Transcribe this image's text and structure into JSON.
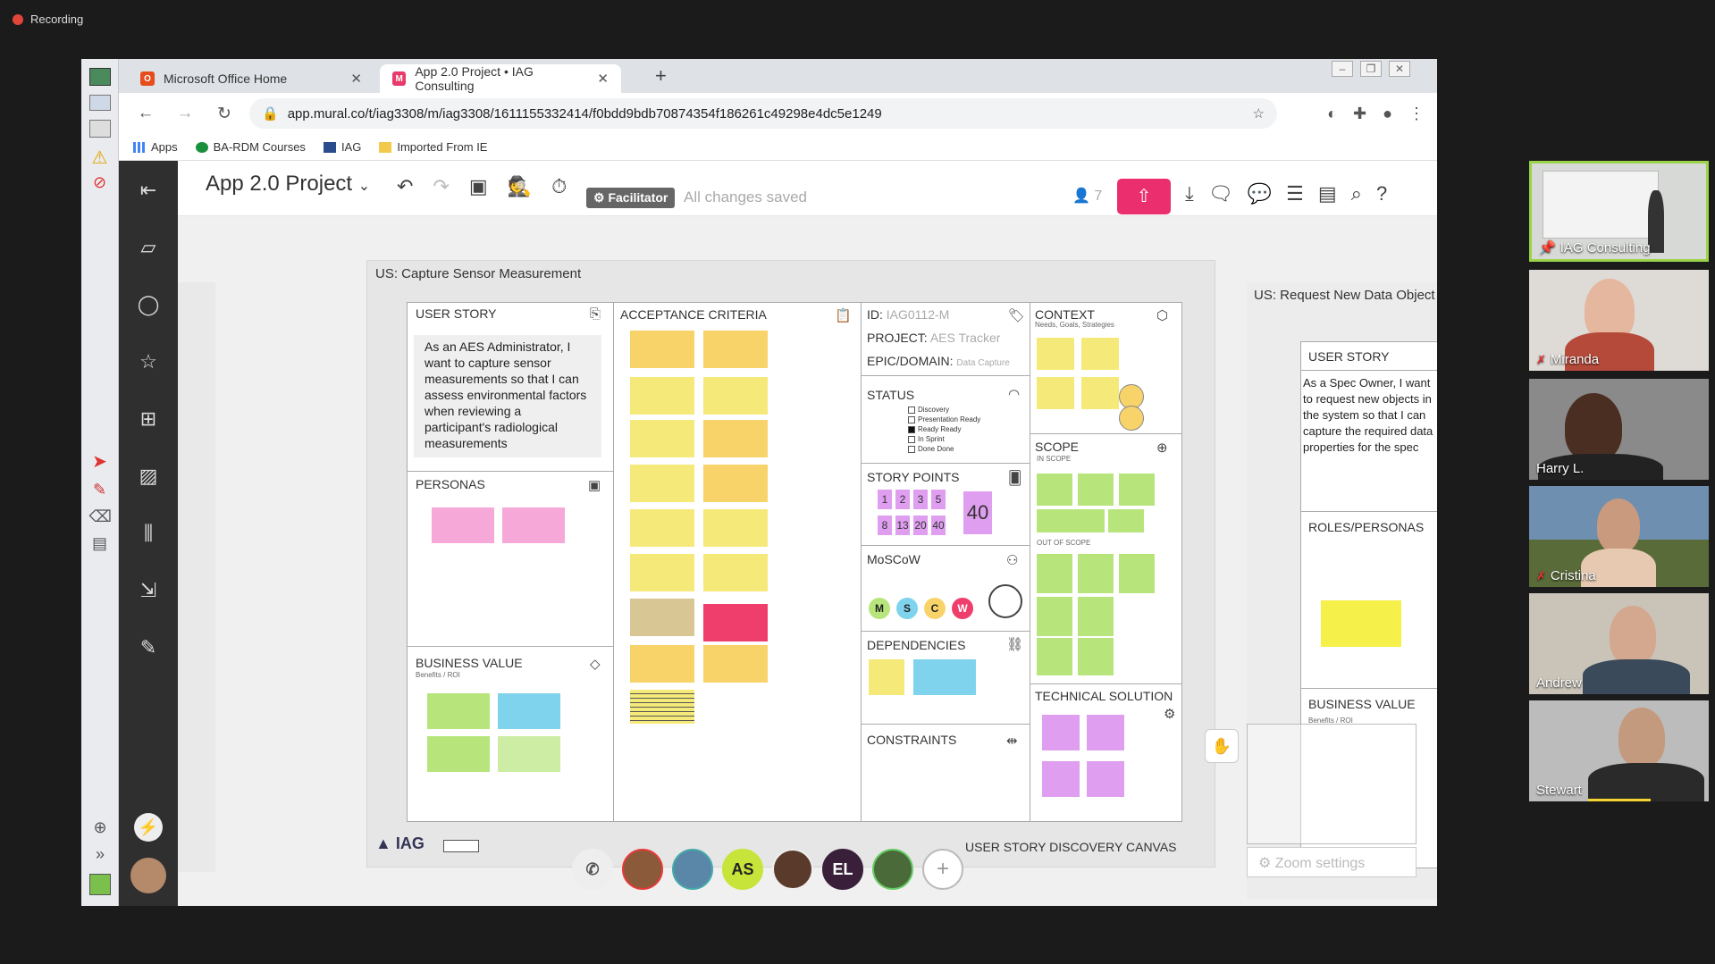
{
  "recording": {
    "label": "Recording"
  },
  "browser": {
    "tabs": [
      {
        "label": "Microsoft Office Home",
        "active": false
      },
      {
        "label": "App 2.0 Project • IAG Consulting",
        "active": true
      }
    ],
    "url": "app.mural.co/t/iag3308/m/iag3308/1611155332414/f0bdd9bdb70874354f186261c49298e4dc5e1249",
    "bookmarks": [
      "Apps",
      "BA-RDM Courses",
      "IAG",
      "Imported From IE"
    ]
  },
  "toolbar": {
    "project_title": "App 2.0 Project",
    "facilitator_label": "Facilitator",
    "save_status": "All changes saved",
    "user_count": "7"
  },
  "canvas": {
    "title": "US: Capture Sensor Measurement",
    "user_story": {
      "header": "USER STORY",
      "text": "As an AES Administrator, I want to capture sensor measurements so that I can assess environmental factors when reviewing a participant's radiological measurements"
    },
    "personas": {
      "header": "PERSONAS"
    },
    "business_value": {
      "header": "BUSINESS VALUE",
      "sub": "Benefits / ROI"
    },
    "acceptance": {
      "header": "ACCEPTANCE CRITERIA"
    },
    "id": {
      "label": "ID:",
      "value": "IAG0112-M"
    },
    "project": {
      "label": "PROJECT:",
      "value": "AES Tracker"
    },
    "epic": {
      "label": "EPIC/DOMAIN:",
      "value": "Data Capture"
    },
    "status": {
      "header": "STATUS",
      "options": [
        {
          "label": "Discovery",
          "checked": false
        },
        {
          "label": "Presentation Ready",
          "checked": false
        },
        {
          "label": "Ready Ready",
          "checked": true
        },
        {
          "label": "In Sprint",
          "checked": false
        },
        {
          "label": "Done Done",
          "checked": false
        }
      ]
    },
    "story_points": {
      "header": "STORY POINTS",
      "row1": [
        "1",
        "2",
        "3",
        "5"
      ],
      "row2": [
        "8",
        "13",
        "20",
        "40"
      ],
      "selected": "40"
    },
    "moscow": {
      "header": "MoSCoW",
      "letters": [
        "M",
        "S",
        "C",
        "W"
      ]
    },
    "dependencies": {
      "header": "DEPENDENCIES"
    },
    "constraints": {
      "header": "CONSTRAINTS"
    },
    "context": {
      "header": "CONTEXT",
      "sub": "Needs, Goals, Strategies"
    },
    "scope": {
      "header": "SCOPE",
      "in": "IN SCOPE",
      "out": "OUT OF SCOPE"
    },
    "technical": {
      "header": "TECHNICAL SOLUTION"
    },
    "footer_right": "USER STORY DISCOVERY CANVAS",
    "footer_logo": "IAG"
  },
  "second_board": {
    "title": "US: Request New Data Object",
    "user_story_header": "USER STORY",
    "text": "As a Spec Owner, I want to request new objects in the system so that I can capture the required data properties for the spec",
    "roles_header": "ROLES/PERSONAS",
    "bv_header": "BUSINESS VALUE",
    "bv_sub": "Benefits / ROI",
    "zoom_settings": "Zoom settings"
  },
  "collaborators": [
    "AS",
    "EL"
  ],
  "participants": [
    {
      "name": "IAG Consulting",
      "muted": false
    },
    {
      "name": "Miranda",
      "muted": true
    },
    {
      "name": "Harry L.",
      "muted": false
    },
    {
      "name": "Cristina",
      "muted": true
    },
    {
      "name": "Andrew",
      "muted": false
    },
    {
      "name": "Stewart",
      "muted": false
    }
  ],
  "colors": {
    "share": "#ea2e6e",
    "selected_tile": "#9bd449",
    "accent": "#ea2e6e"
  }
}
